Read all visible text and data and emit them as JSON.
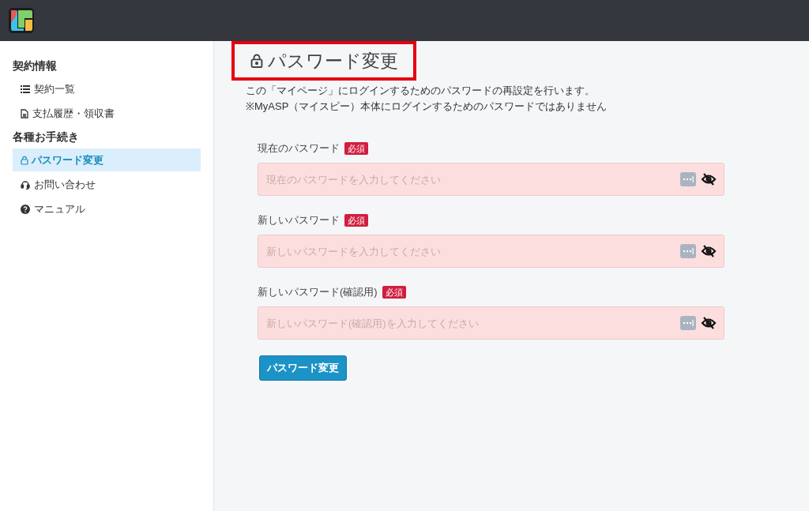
{
  "sidebar": {
    "sections": [
      {
        "heading": "契約情報",
        "items": [
          {
            "kind": "list",
            "label": "契約一覧",
            "selected": false
          },
          {
            "kind": "document",
            "label": "支払履歴・領収書",
            "selected": false
          }
        ]
      },
      {
        "heading": "各種お手続き",
        "items": [
          {
            "kind": "lock",
            "label": "パスワード変更",
            "selected": true
          },
          {
            "kind": "headset",
            "label": "お問い合わせ",
            "selected": false
          },
          {
            "kind": "help",
            "label": "マニュアル",
            "selected": false
          }
        ]
      }
    ]
  },
  "page": {
    "title": "パスワード変更",
    "description": [
      "この「マイページ」にログインするためのパスワードの再設定を行います。",
      "※MyASP（マイスピー）本体にログインするためのパスワードではありません"
    ],
    "fields": [
      {
        "label": "現在のパスワード",
        "required_badge": "必須",
        "placeholder": "現在のパスワードを入力してください"
      },
      {
        "label": "新しいパスワード",
        "required_badge": "必須",
        "placeholder": "新しいパスワードを入力してください"
      },
      {
        "label": "新しいパスワード(確認用)",
        "required_badge": "必須",
        "placeholder": "新しいパスワード(確認用)を入力してください"
      }
    ],
    "submit_button": "パスワード変更"
  }
}
